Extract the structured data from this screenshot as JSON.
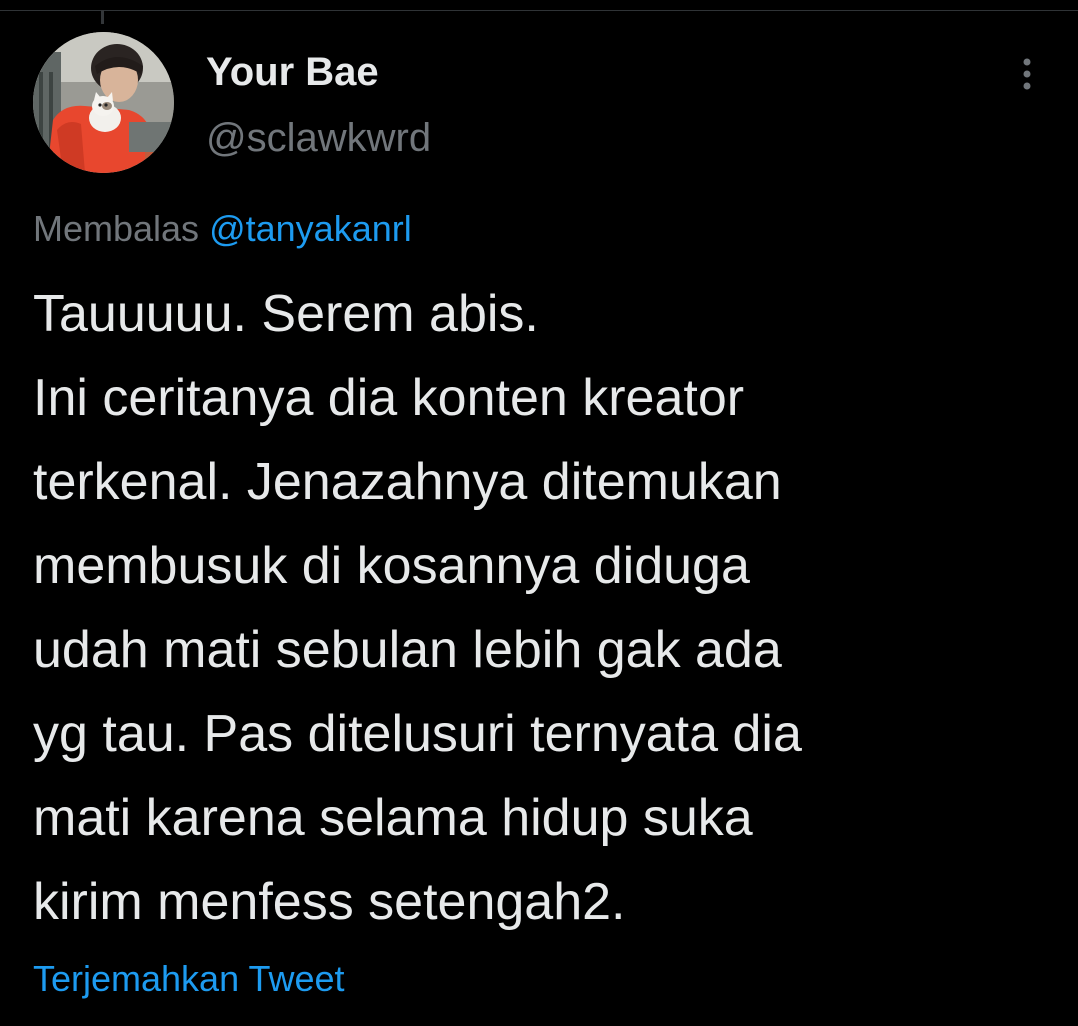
{
  "tweet": {
    "author": {
      "display_name": "Your Bae",
      "handle": "@sclawkwrd",
      "avatar_icon": "profile-photo"
    },
    "more_options_icon": "vertical-ellipsis-icon",
    "reply_context": {
      "prefix": "Membalas",
      "mention": "@tanyakanrl"
    },
    "text_lines": [
      "Tauuuuu. Serem abis.",
      "Ini ceritanya dia konten kreator",
      "terkenal. Jenazahnya ditemukan",
      "membusuk di kosannya diduga",
      "udah mati sebulan lebih gak ada",
      "yg tau. Pas ditelusuri ternyata dia",
      "mati karena selama hidup suka",
      "kirim menfess setengah2."
    ],
    "translate_label": "Terjemahkan Tweet"
  },
  "colors": {
    "background": "#000000",
    "primary_text": "#e7e9ea",
    "secondary_text": "#71767b",
    "link": "#1d9bf0",
    "divider": "#2f3336"
  }
}
